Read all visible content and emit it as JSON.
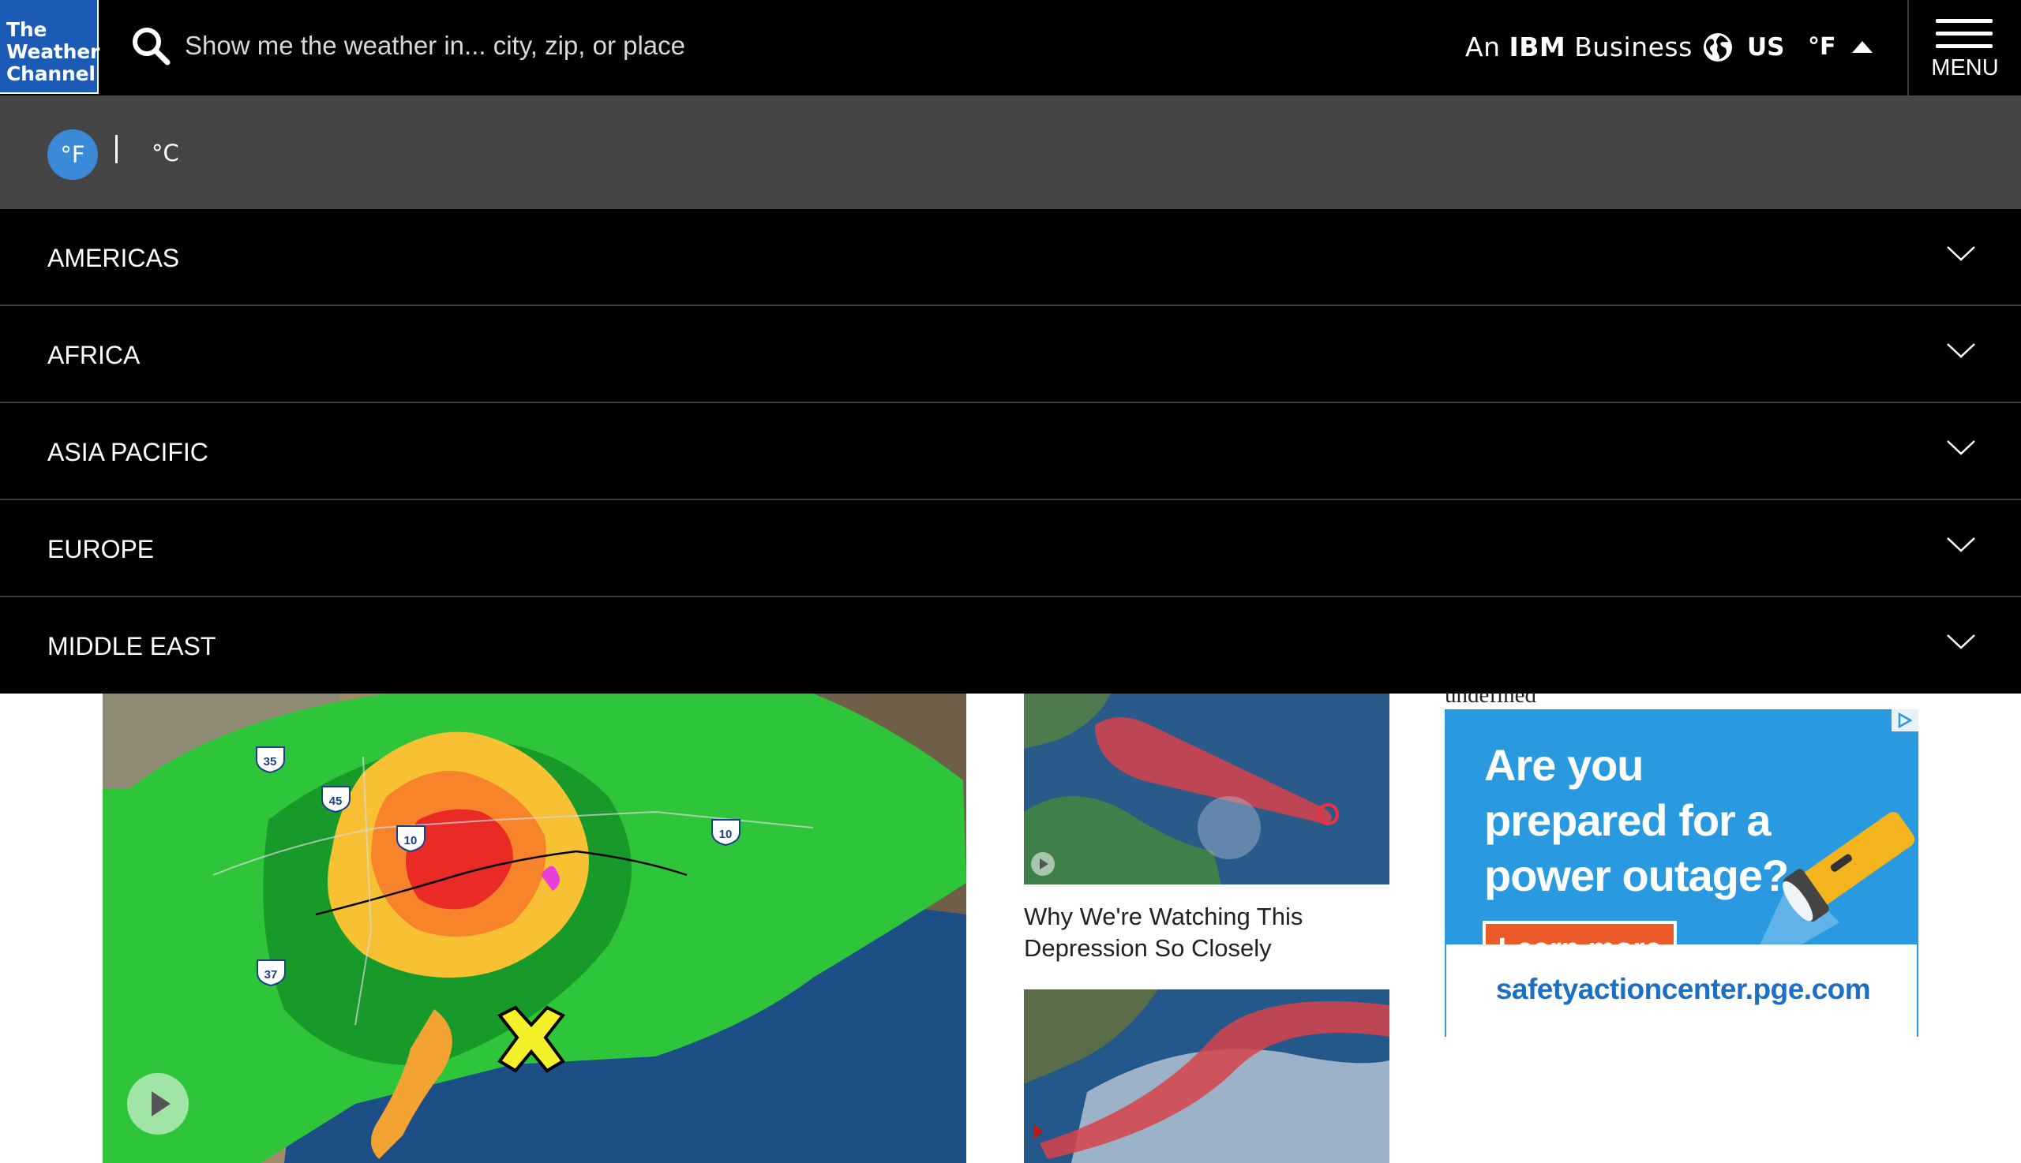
{
  "header": {
    "logo_lines": [
      "The",
      "Weather",
      "Channel"
    ],
    "search_placeholder": "Show me the weather in... city, zip, or place",
    "ibm_prefix": "An",
    "ibm_brand": "IBM",
    "ibm_suffix": "Business",
    "locale": "US",
    "unit": "°F",
    "menu_label": "MENU"
  },
  "unit_bar": {
    "fahrenheit": "°F",
    "separator": "|",
    "celsius": "°C"
  },
  "regions": [
    {
      "label": "AMERICAS"
    },
    {
      "label": "AFRICA"
    },
    {
      "label": "ASIA PACIFIC"
    },
    {
      "label": "EUROPE"
    },
    {
      "label": "MIDDLE EAST"
    }
  ],
  "content": {
    "undefined_text": "undefined",
    "headline_1": "Why We're Watching This Depression So Closely",
    "highway_shields": [
      "35",
      "45",
      "10",
      "10",
      "37"
    ]
  },
  "ad": {
    "headline": "Are you prepared for a power outage?",
    "cta": "Learn more",
    "url": "safetyactioncenter.pge.com"
  },
  "colors": {
    "header_bg": "#000000",
    "logo_bg": "#1b5bb6",
    "unitbar_bg": "#454545",
    "unit_active": "#3b8ad8",
    "ad_bg": "#2a9ae0",
    "ad_cta": "#ee5b2b"
  }
}
